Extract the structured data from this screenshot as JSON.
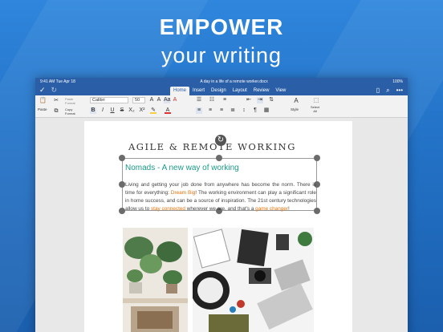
{
  "promo": {
    "line1": "EMPOWER",
    "line2": "your writing"
  },
  "status_bar": {
    "time": "9:41 AM  Tue Apr 18",
    "doc_name": "A day in a life of a remote worker.docx",
    "battery": "100%"
  },
  "tabs": [
    {
      "label": "Home",
      "active": true
    },
    {
      "label": "Insert",
      "active": false
    },
    {
      "label": "Design",
      "active": false
    },
    {
      "label": "Layout",
      "active": false
    },
    {
      "label": "Review",
      "active": false
    },
    {
      "label": "View",
      "active": false
    }
  ],
  "ribbon": {
    "paste_label": "Paste",
    "paste_format_label": "Paste\nFormat",
    "copy_format_label": "Copy\nFormat",
    "font_name": "Calibri",
    "font_size": "50",
    "style_label": "Style",
    "select_all_label": "Select\nAll"
  },
  "document": {
    "title": "AGILE & REMOTE WORKING",
    "subtitle": "Nomads - A new way of working",
    "body_parts": [
      {
        "text": "Living and getting your job done from anywhere has become the norm. There is time for everything: ",
        "hl": false
      },
      {
        "text": "Dream Big",
        "hl": true
      },
      {
        "text": "! The working environment can play a significant role in home success, and can be a source of inspiration. The 21st century technologies allow us to ",
        "hl": false
      },
      {
        "text": "stay connected",
        "hl": true
      },
      {
        "text": " wherever we are, and that's a ",
        "hl": false
      },
      {
        "text": "game changer",
        "hl": true
      },
      {
        "text": "!",
        "hl": false
      }
    ]
  },
  "colors": {
    "accent": "#2a5fa8",
    "subtitle": "#1a9a87",
    "highlight": "#e8740c"
  },
  "icons": [
    "check-icon",
    "redo-icon",
    "tablet-view-icon",
    "search-icon",
    "more-icon",
    "cut-icon",
    "copy-icon",
    "paste-icon",
    "bold-icon",
    "italic-icon",
    "underline-icon",
    "strikethrough-icon",
    "subscript-icon",
    "superscript-icon",
    "highlight-icon",
    "font-color-icon",
    "bullets-icon",
    "numbering-icon",
    "align-left-icon",
    "align-center-icon",
    "align-right-icon",
    "justify-icon",
    "line-spacing-icon",
    "paragraph-mark-icon",
    "style-icon",
    "select-all-icon",
    "refresh-icon"
  ]
}
